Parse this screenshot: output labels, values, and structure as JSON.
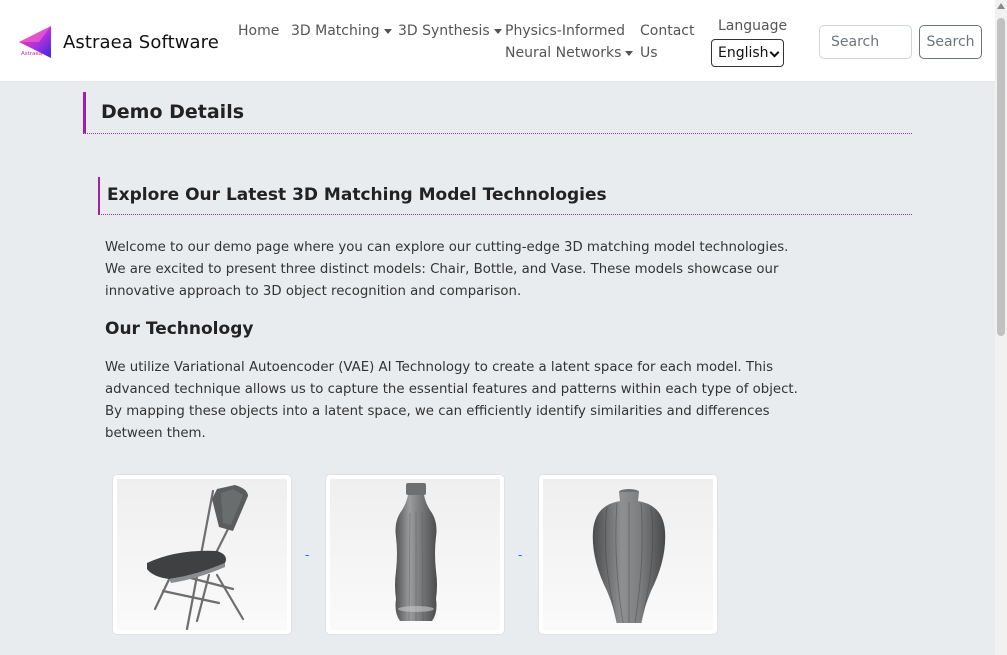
{
  "brand": {
    "name": "Astraea Software",
    "logo_text": "Astraea"
  },
  "nav": {
    "home": "Home",
    "matching": "3D Matching",
    "synthesis": "3D Synthesis",
    "pinn_line1": "Physics-Informed",
    "pinn_line2": "Neural Networks",
    "contact_line1": "Contact",
    "contact_line2": "Us"
  },
  "language": {
    "label": "Language",
    "selected": "English"
  },
  "search": {
    "placeholder": "Search",
    "button": "Search"
  },
  "page": {
    "title": "Demo Details"
  },
  "section": {
    "heading": "Explore Our Latest 3D Matching Model Technologies",
    "intro": [
      "Welcome to our demo page where you can explore our cutting-edge 3D matching model technologies.",
      "We are excited to present three distinct models: Chair, Bottle, and Vase. These models showcase our",
      "innovative approach to 3D object recognition and comparison."
    ],
    "tech_heading": "Our Technology",
    "tech": [
      "We utilize Variational Autoencoder (VAE) AI Technology to create a latent space for each model. This",
      "advanced technique allows us to capture the essential features and patterns within each type of object.",
      "By mapping these objects into a latent space, we can efficiently identify similarities and differences",
      "between them."
    ]
  },
  "models": [
    {
      "name": "Chair",
      "icon": "chair-model"
    },
    {
      "name": "Bottle",
      "icon": "bottle-model"
    },
    {
      "name": "Vase",
      "icon": "vase-model"
    }
  ],
  "separator": "-",
  "colors": {
    "accent": "#a31fa8",
    "link": "#0d6efd",
    "background": "#e9ecef"
  }
}
